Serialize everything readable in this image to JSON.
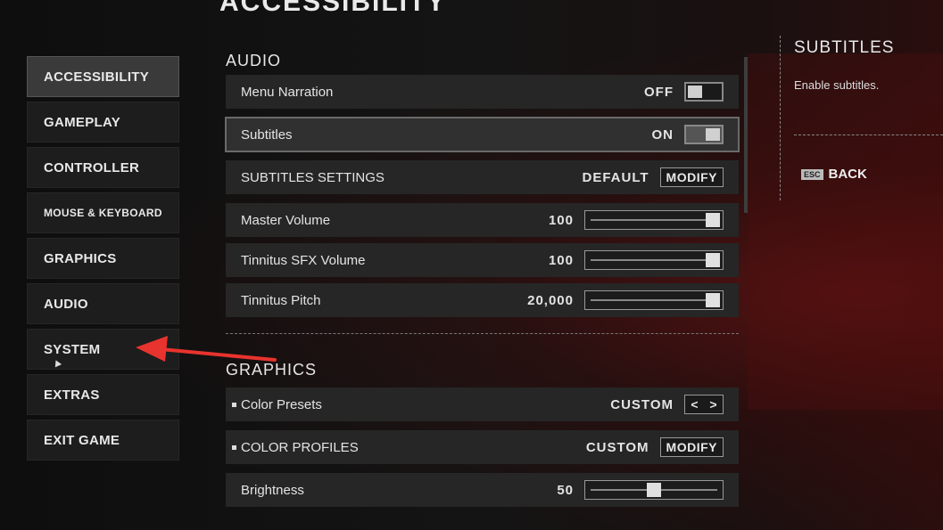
{
  "page_title": "ACCESSIBILITY",
  "sidebar": {
    "items": [
      {
        "label": "ACCESSIBILITY",
        "active": true
      },
      {
        "label": "GAMEPLAY"
      },
      {
        "label": "CONTROLLER"
      },
      {
        "label": "MOUSE & KEYBOARD"
      },
      {
        "label": "GRAPHICS"
      },
      {
        "label": "AUDIO"
      },
      {
        "label": "SYSTEM"
      },
      {
        "label": "EXTRAS"
      },
      {
        "label": "EXIT GAME"
      }
    ]
  },
  "audio": {
    "title": "AUDIO",
    "menu_narration": {
      "label": "Menu Narration",
      "value": "OFF"
    },
    "subtitles": {
      "label": "Subtitles",
      "value": "ON"
    },
    "subtitles_settings": {
      "label": "SUBTITLES SETTINGS",
      "value": "DEFAULT",
      "button": "MODIFY"
    },
    "master_volume": {
      "label": "Master Volume",
      "value": "100",
      "level": 1.0
    },
    "tinnitus_sfx": {
      "label": "Tinnitus SFX Volume",
      "value": "100",
      "level": 1.0
    },
    "tinnitus_pitch": {
      "label": "Tinnitus Pitch",
      "value": "20,000",
      "level": 1.0
    }
  },
  "graphics": {
    "title": "GRAPHICS",
    "color_presets": {
      "label": "Color Presets",
      "value": "CUSTOM",
      "prev": "<",
      "next": ">"
    },
    "color_profiles": {
      "label": "COLOR PROFILES",
      "value": "CUSTOM",
      "button": "MODIFY"
    },
    "brightness": {
      "label": "Brightness",
      "value": "50",
      "level": 0.5
    }
  },
  "info_panel": {
    "title": "SUBTITLES",
    "description": "Enable subtitles.",
    "back_key": "ESC",
    "back_label": "BACK"
  },
  "colors": {
    "annotation_arrow": "#e8332e",
    "accent_panel": "#3a3a3a"
  }
}
